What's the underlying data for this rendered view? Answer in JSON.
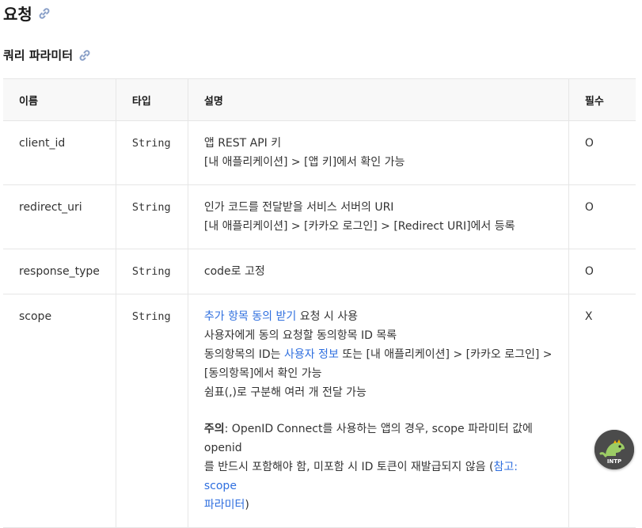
{
  "heading_request": "요청",
  "heading_query": "쿼리 파라미터",
  "table": {
    "headers": [
      "이름",
      "타입",
      "설명",
      "필수"
    ],
    "rows": [
      {
        "name": "client_id",
        "type": "String",
        "desc": [
          "앱 REST API 키",
          "[내 애플리케이션] > [앱 키]에서 확인 가능"
        ],
        "required": "O"
      },
      {
        "name": "redirect_uri",
        "type": "String",
        "desc": [
          "인가 코드를 전달받을 서비스 서버의 URI",
          "[내 애플리케이션] > [카카오 로그인] > [Redirect URI]에서 등록"
        ],
        "required": "O"
      },
      {
        "name": "response_type",
        "type": "String",
        "desc_code": "code",
        "desc_rest": "로 고정",
        "required": "O"
      },
      {
        "name": "scope",
        "type": "String",
        "l1_link": "추가 항목 동의 받기",
        "l1_rest": " 요청 시 사용",
        "l2": "사용자에게 동의 요청할 동의항목 ID 목록",
        "l3_pre": "동의항목의 ID는 ",
        "l3_link": "사용자 정보",
        "l3_post": " 또는 [내 애플리케이션] > [카카오 로그인] >",
        "l4": "[동의항목]에서 확인 가능",
        "l5": "쉼표(,)로 구분해 여러 개 전달 가능",
        "note_label": "주의",
        "note_a": ": OpenID Connect를 사용하는 앱의 경우, scope 파라미터 값에 openid",
        "note_b": "를 반드시 포함해야 함, 미포함 시 ID 토큰이 재발급되지 않음 (",
        "note_link_a": "참고: scope",
        "note_link_b": "파라미터",
        "note_end": ")",
        "required": "X"
      }
    ]
  },
  "badge_text": "INTP",
  "colors": {
    "link": "#2f6fdf",
    "header_bg": "#f8f8f8",
    "border": "#e6e6e6"
  }
}
